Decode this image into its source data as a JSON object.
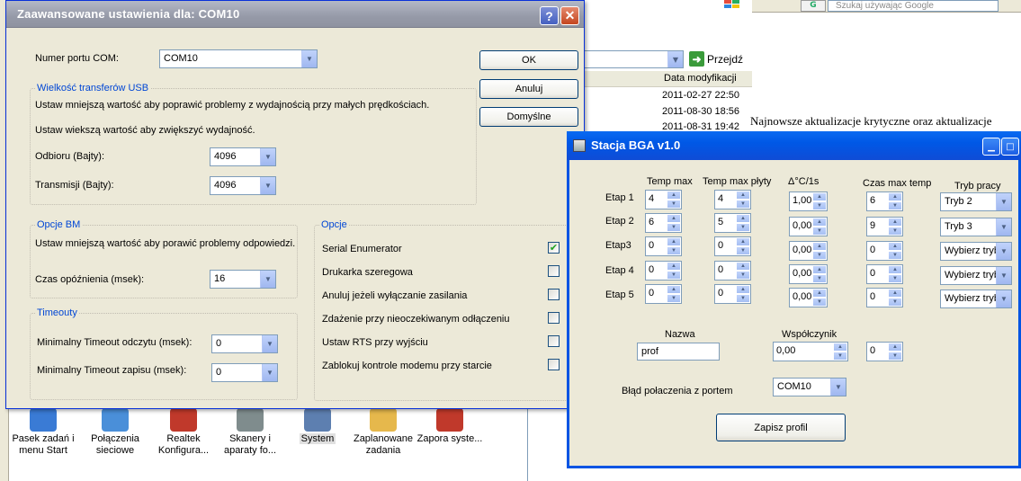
{
  "background": {
    "explorer": {
      "go_label": "Przejdź",
      "column_header": "Data modyfikacji",
      "dates": [
        "2011-02-27 22:50",
        "2011-08-30 18:56",
        "2011-08-31 19:42"
      ]
    },
    "ie": {
      "search_placeholder": "Szukaj używając Google",
      "text_line": "Najnowsze aktualizacje krytyczne oraz aktualizacje"
    },
    "control_panel": [
      {
        "label": "Pasek zadań i menu Start",
        "color": "#3a7bd5"
      },
      {
        "label": "Połączenia sieciowe",
        "color": "#4a8fd9"
      },
      {
        "label": "Realtek Konfigura...",
        "color": "#c0392b"
      },
      {
        "label": "Skanery i aparaty fo...",
        "color": "#7f8c8d"
      },
      {
        "label": "System",
        "color": "#5d7fb0"
      },
      {
        "label": "Zaplanowane zadania",
        "color": "#e6b84c"
      },
      {
        "label": "Zapora syste...",
        "color": "#c0392b"
      }
    ]
  },
  "dialog1": {
    "title": "Zaawansowane ustawienia dla: COM10",
    "help_glyph": "?",
    "close_glyph": "✕",
    "port_label": "Numer portu COM:",
    "port_value": "COM10",
    "usb_group": "Wielkość transferów USB",
    "usb_hint1": "Ustaw mniejszą wartość aby poprawić problemy z wydajnością przy małych prędkościach.",
    "usb_hint2": "Ustaw wiekszą wartość aby zwiększyć wydajność.",
    "rx_label": "Odbioru (Bajty):",
    "rx_value": "4096",
    "tx_label": "Transmisji (Bajty):",
    "tx_value": "4096",
    "bm_group": "Opcje BM",
    "bm_hint": "Ustaw mniejszą wartość aby porawić problemy odpowiedzi.",
    "latency_label": "Czas opóźnienia (msek):",
    "latency_value": "16",
    "timeouts_group": "Timeouty",
    "read_timeout_label": "Minimalny Timeout odczytu (msek):",
    "read_timeout_value": "0",
    "write_timeout_label": "Minimalny Timeout zapisu (msek):",
    "write_timeout_value": "0",
    "options_group": "Opcje",
    "options": [
      {
        "label": "Serial Enumerator",
        "checked": true
      },
      {
        "label": "Drukarka szeregowa",
        "checked": false
      },
      {
        "label": "Anuluj jeżeli wyłączanie zasilania",
        "checked": false
      },
      {
        "label": "Zdażenie przy nieoczekiwanym odłączeniu",
        "checked": false
      },
      {
        "label": "Ustaw RTS przy wyjściu",
        "checked": false
      },
      {
        "label": "Zablokuj kontrole modemu przy starcie",
        "checked": false
      }
    ],
    "ok_label": "OK",
    "cancel_label": "Anuluj",
    "defaults_label": "Domyślne"
  },
  "dialog2": {
    "title": "Stacja BGA v1.0",
    "headers": {
      "temp_max": "Temp max",
      "temp_max_plyty": "Temp max płyty",
      "rate": "Δ°C/1s",
      "czas": "Czas max temp",
      "tryb": "Tryb pracy"
    },
    "stages": [
      {
        "label": "Etap 1",
        "temp_max": "4",
        "temp_plyty": "4",
        "rate": "1,00",
        "czas": "6",
        "tryb": "Tryb 2"
      },
      {
        "label": "Etap 2",
        "temp_max": "6",
        "temp_plyty": "5",
        "rate": "0,00",
        "czas": "9",
        "tryb": "Tryb 3"
      },
      {
        "label": "Etap3",
        "temp_max": "0",
        "temp_plyty": "0",
        "rate": "0,00",
        "czas": "0",
        "tryb": "Wybierz tryb"
      },
      {
        "label": "Etap 4",
        "temp_max": "0",
        "temp_plyty": "0",
        "rate": "0,00",
        "czas": "0",
        "tryb": "Wybierz tryb"
      },
      {
        "label": "Etap 5",
        "temp_max": "0",
        "temp_plyty": "0",
        "rate": "0,00",
        "czas": "0",
        "tryb": "Wybierz tryb"
      }
    ],
    "name_label": "Nazwa",
    "name_value": "prof",
    "coef_label": "Współczynik",
    "coef_value": "0,00",
    "extra_value": "0",
    "status_label": "Błąd połaczenia z portem",
    "port_value": "COM10",
    "save_label": "Zapisz profil"
  }
}
